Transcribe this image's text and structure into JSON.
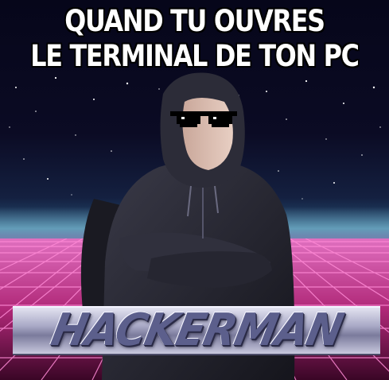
{
  "caption": {
    "line1": "QUAND TU OUVRES",
    "line2": "LE TERMINAL DE TON PC"
  },
  "banner": {
    "text": "HACKERMAN"
  }
}
